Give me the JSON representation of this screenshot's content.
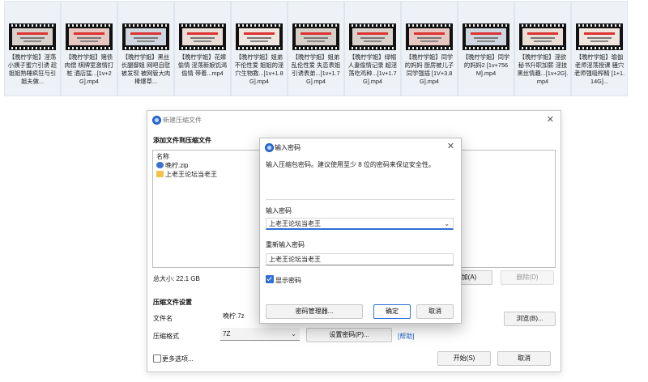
{
  "files": [
    "【晚柠学姐】淫荡小姨子蜜穴引诱 趁姐姐熟睡疯狂与引姐夫做...",
    "【晚柠学姐】赌债肉偿 棋牌室激情打桩 酒店猛...[1v+2G].mp4",
    "【晚柠学姐】黑丝长腿御姐 网吧自慰被发现 被网管大肉棒爆草...",
    "【晚柠学姐】花嫁偷情 淫荡新娘饥渴偷情 带着...mp4",
    "【晚柠学姐】姐弟不伦性爱 姐姐的淫穴生物教...[1v+1.8G].mp4",
    "【晚柠学姐】姐弟乱伦性爱 失恋表姐引诱表弟...[1v+1.7G].mp4",
    "【晚柠学姐】绿帽人妻偷情记录 超淫荡吃鸡种...[1v+1.7G].mp4",
    "【晚柠学姐】同学的妈妈 厨房被儿子同学强插 [1V+3.8G].mp4",
    "【晚柠学姐】同学的妈妈2 [1v+756M].mp4",
    "【晚柠学姐】淫欲秘书升职加薪 淫技 黑丝情趣...[1v+2G].mp4",
    "【晚柠学姐】瑜伽老师淫荡授课 骚穴老师强吸榨精 [1+1.14G]..."
  ],
  "dialog": {
    "title": "新建压缩文件",
    "add_section": "添加文件到压缩文件",
    "list_header": "名称",
    "list_items": [
      "晚柠.zip",
      "上老王论坛当老王"
    ],
    "total_size": "总大小: 22.1 GB",
    "add_button": "添加(A)",
    "delete_button": "删除(D)",
    "settings_section": "压缩文件设置",
    "filename_label": "文件名",
    "filename_value": "晚柠.7z",
    "browse_button": "浏览(B)...",
    "format_label": "压缩格式",
    "format_value": "7Z",
    "set_password_button": "设置密码(P)...",
    "help_link": "[帮助]",
    "more_options": "更多选项...",
    "start_button": "开始(S)",
    "cancel_button": "取消"
  },
  "password_dialog": {
    "title": "输入密码",
    "info": "输入压缩包密码。建议使用至少 8 位的密码来保证安全性。",
    "password_label": "输入密码",
    "password_value": "上老王论坛当老王",
    "repeat_label": "重新输入密码",
    "repeat_value": "上老王论坛当老王",
    "show_password": "显示密码",
    "show_password_checked": true,
    "manager_button": "密码管理器...",
    "ok_button": "确定",
    "cancel_button": "取消"
  },
  "colors": {
    "accent": "#2f6fd6",
    "tile_bg": "#eef2f7",
    "link": "#2463c7"
  }
}
